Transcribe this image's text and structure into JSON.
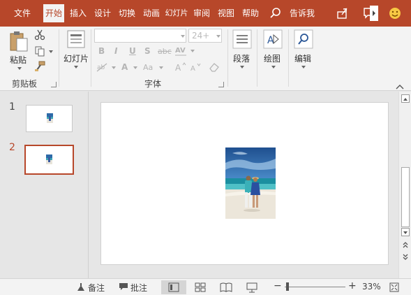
{
  "tabs": [
    "文件",
    "开始",
    "插入",
    "设计",
    "切换",
    "动画",
    "幻灯片",
    "审阅",
    "视图",
    "帮助"
  ],
  "active_tab": "开始",
  "tell_me": "告诉我",
  "colors": {
    "accent": "#b7472a",
    "ribbon_bg": "#f3f3f3",
    "workspace_bg": "#e6e6e6"
  },
  "ribbon": {
    "clipboard": {
      "paste": "粘贴",
      "group": "剪贴板"
    },
    "slides": {
      "new_slide": "幻灯片"
    },
    "font": {
      "font_name": "",
      "font_size": "24+",
      "bold": "B",
      "italic": "I",
      "underline": "U",
      "strike": "S",
      "spacing": "abc",
      "group": "字体"
    },
    "paragraph": {
      "label": "段落"
    },
    "drawing": {
      "label": "绘图"
    },
    "editing": {
      "label": "编辑"
    }
  },
  "slides": [
    {
      "number": "1",
      "selected": false
    },
    {
      "number": "2",
      "selected": true
    }
  ],
  "status": {
    "notes": "备注",
    "comments": "批注",
    "zoom": "33%"
  }
}
